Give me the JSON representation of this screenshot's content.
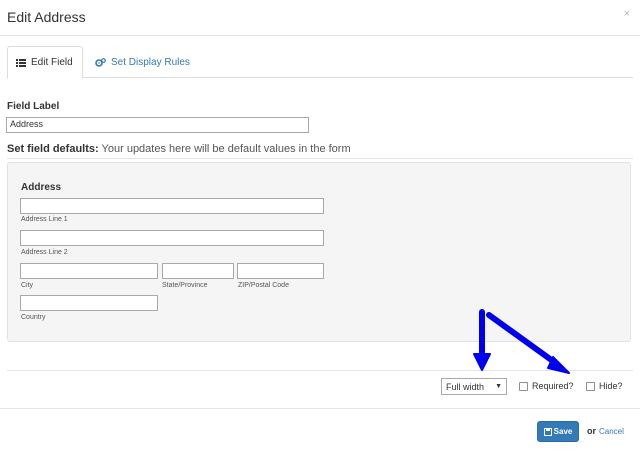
{
  "modal": {
    "title": "Edit Address",
    "close": "×"
  },
  "tabs": [
    {
      "label": "Edit Field",
      "active": true
    },
    {
      "label": "Set Display Rules",
      "active": false
    }
  ],
  "field_label": {
    "label": "Field Label",
    "value": "Address"
  },
  "defaults": {
    "heading": "Set field defaults:",
    "description": " Your updates here will be default values in the form"
  },
  "address_block": {
    "title": "Address",
    "line1": {
      "label": "Address Line 1",
      "value": ""
    },
    "line2": {
      "label": "Address Line 2",
      "value": ""
    },
    "city": {
      "label": "City",
      "value": ""
    },
    "state": {
      "label": "State/Province",
      "value": ""
    },
    "zip": {
      "label": "ZIP/Postal Code",
      "value": ""
    },
    "country": {
      "label": "Country",
      "value": ""
    }
  },
  "options": {
    "width_select": "Full width",
    "width_arrow": "▼",
    "required_label": "Required?",
    "hide_label": "Hide?"
  },
  "footer": {
    "save_label": "Save",
    "or_text": "or",
    "cancel_label": "Cancel"
  },
  "colors": {
    "primary": "#337ab7",
    "annotation_arrow": "#0000ee"
  },
  "icons": {
    "edit_field": "list-icon",
    "display_rules": "cogs-icon",
    "save": "floppy-disk-icon"
  }
}
